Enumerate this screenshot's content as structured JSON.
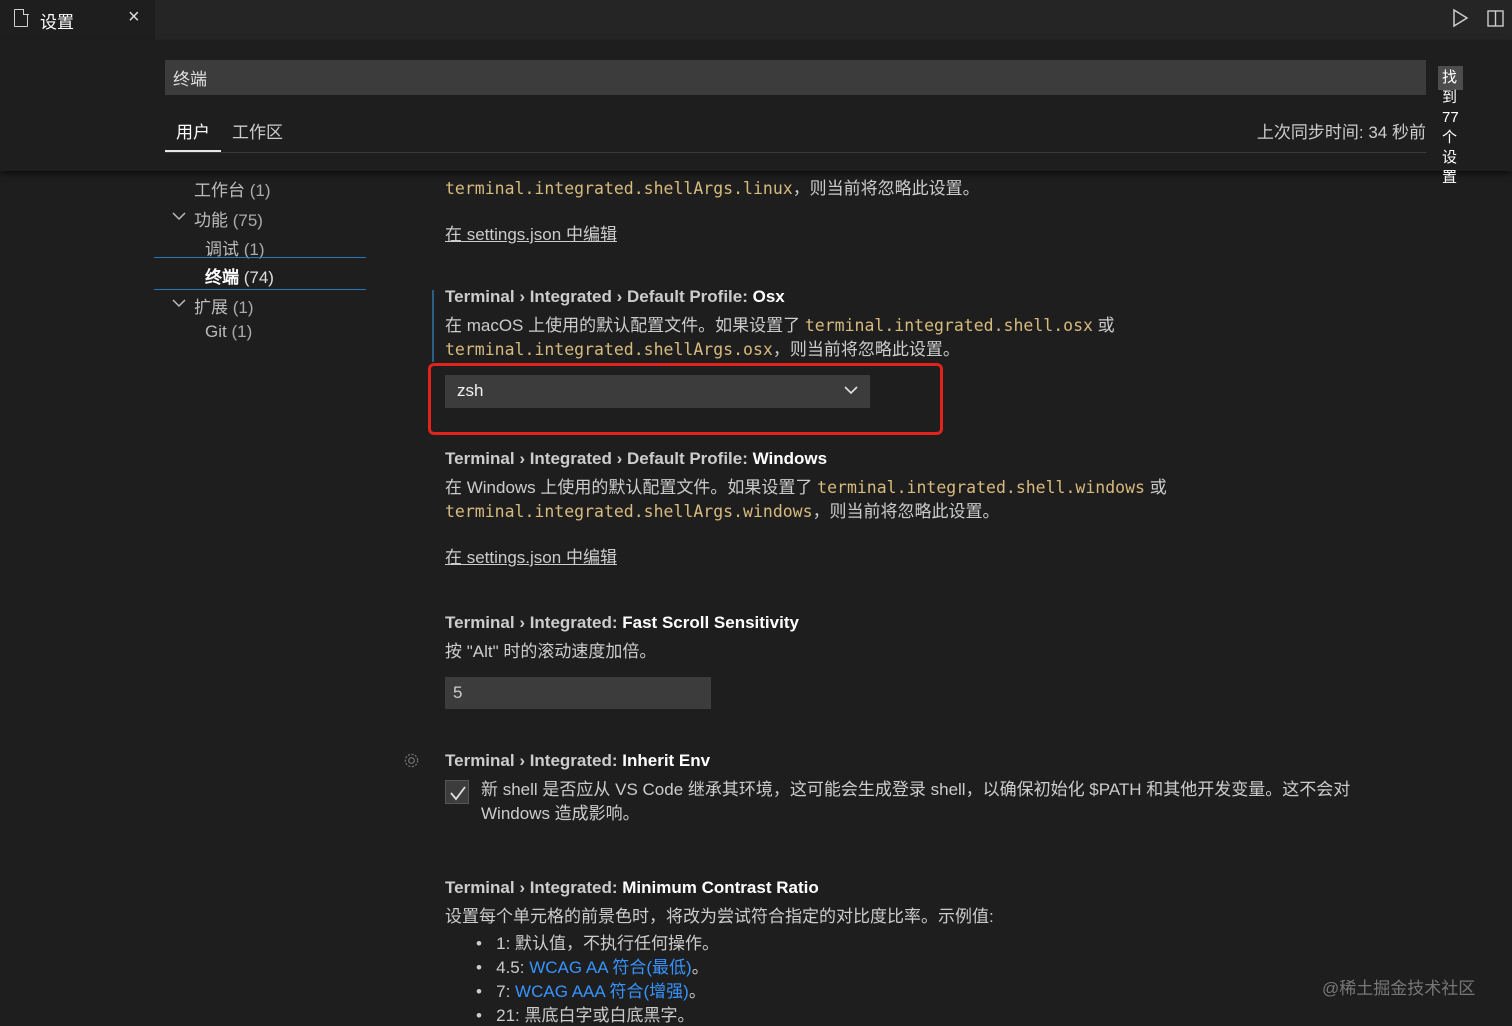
{
  "tab": {
    "title": "设置",
    "close": "×"
  },
  "icons": {
    "file": "file-icon",
    "close": "close-icon",
    "run": "run-icon",
    "split": "split-editor-icon",
    "filter": "filter-icon",
    "chevron": "chevron-down-icon",
    "gear": "gear-icon",
    "check": "check-icon"
  },
  "search": {
    "value": "终端",
    "result_count": "找到 77 个设置"
  },
  "scope_tabs": {
    "user": "用户",
    "workspace": "工作区"
  },
  "sync_status": "上次同步时间: 34 秒前",
  "toc": {
    "workbench": {
      "label": "工作台",
      "count": "(1)"
    },
    "features": {
      "label": "功能",
      "count": "(75)"
    },
    "debug": {
      "label": "调试",
      "count": "(1)"
    },
    "terminal": {
      "label": "终端",
      "count": "(74)"
    },
    "extensions": {
      "label": "扩展",
      "count": "(1)"
    },
    "git": {
      "label": "Git",
      "count": "(1)"
    }
  },
  "settings": {
    "linux": {
      "desc_line2_code": "terminal.integrated.shellArgs.linux",
      "desc_line2_text": "，则当前将忽略此设置。",
      "edit_link": "在 settings.json 中编辑"
    },
    "osx": {
      "category": "Terminal › Integrated › Default Profile: ",
      "name": "Osx",
      "desc_prefix": "在 macOS 上使用的默认配置文件。如果设置了 ",
      "desc_code1": "terminal.integrated.shell.osx",
      "desc_or": " 或",
      "desc_code2": "terminal.integrated.shellArgs.osx",
      "desc_suffix": "，则当前将忽略此设置。",
      "value": "zsh"
    },
    "windows": {
      "category": "Terminal › Integrated › Default Profile: ",
      "name": "Windows",
      "desc_prefix": "在 Windows 上使用的默认配置文件。如果设置了 ",
      "desc_code1": "terminal.integrated.shell.windows",
      "desc_or": " 或",
      "desc_code2": "terminal.integrated.shellArgs.windows",
      "desc_suffix": "，则当前将忽略此设置。",
      "edit_link": "在 settings.json 中编辑"
    },
    "fast_scroll": {
      "category": "Terminal › Integrated: ",
      "name": "Fast Scroll Sensitivity",
      "desc": "按 \"Alt\" 时的滚动速度加倍。",
      "value": "5"
    },
    "inherit_env": {
      "category": "Terminal › Integrated: ",
      "name": "Inherit Env",
      "desc_line1": "新 shell 是否应从 VS Code 继承其环境，这可能会生成登录 shell，以确保初始化 $PATH 和其他开发变量。这不会对",
      "desc_line2": "Windows 造成影响。",
      "checked": true
    },
    "contrast": {
      "category": "Terminal › Integrated: ",
      "name": "Minimum Contrast Ratio",
      "desc": "设置每个单元格的前景色时，将改为尝试符合指定的对比度比率。示例值:",
      "items": [
        {
          "prefix": "1: ",
          "text": "默认值，不执行任何操作。",
          "link": ""
        },
        {
          "prefix": "4.5: ",
          "text": "。",
          "link": "WCAG AA 符合(最低)"
        },
        {
          "prefix": "7: ",
          "text": "。",
          "link": "WCAG AAA 符合(增强)"
        },
        {
          "prefix": "21: ",
          "text": "黑底白字或白底黑字。",
          "link": ""
        }
      ]
    }
  },
  "watermark": "@稀土掘金技术社区",
  "colors": {
    "accent": "#2c78b8",
    "highlight_box": "#e0231c",
    "code": "#d7ba7d",
    "link": "#3794ff"
  }
}
